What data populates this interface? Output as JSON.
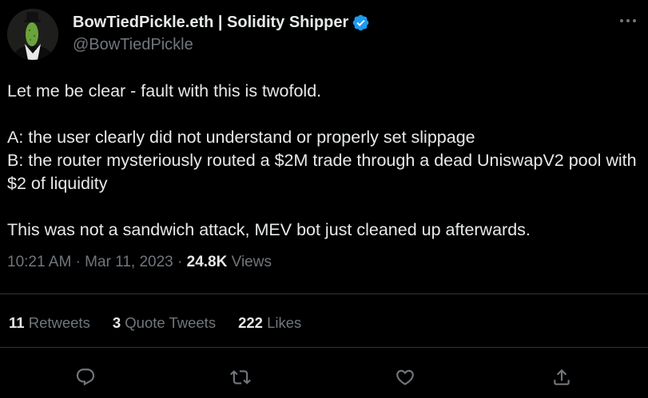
{
  "author": {
    "display_name": "BowTiedPickle.eth | Solidity Shipper",
    "handle": "@BowTiedPickle",
    "verified_color": "#1d9bf0"
  },
  "icons": {
    "more": "more-horizontal-icon",
    "verified": "verified-badge-icon",
    "reply": "reply-icon",
    "retweet": "retweet-icon",
    "like": "like-icon",
    "share": "share-icon"
  },
  "tweet": {
    "line1": "Let me be clear - fault with this is twofold.",
    "line2": "A: the user clearly did not understand or properly set slippage",
    "line3": "B: the router mysteriously routed a $2M trade through a dead UniswapV2 pool with $2 of liquidity",
    "line4": "This was not a sandwich attack, MEV bot just cleaned up afterwards."
  },
  "meta": {
    "time": "10:21 AM",
    "date": "Mar 11, 2023",
    "views_count": "24.8K",
    "views_label": "Views"
  },
  "stats": {
    "retweets_count": "11",
    "retweets_label": "Retweets",
    "quotes_count": "3",
    "quotes_label": "Quote Tweets",
    "likes_count": "222",
    "likes_label": "Likes"
  },
  "colors": {
    "background": "#000000",
    "text": "#e7e9ea",
    "secondary_text": "#71767b",
    "divider": "#2f3336"
  }
}
